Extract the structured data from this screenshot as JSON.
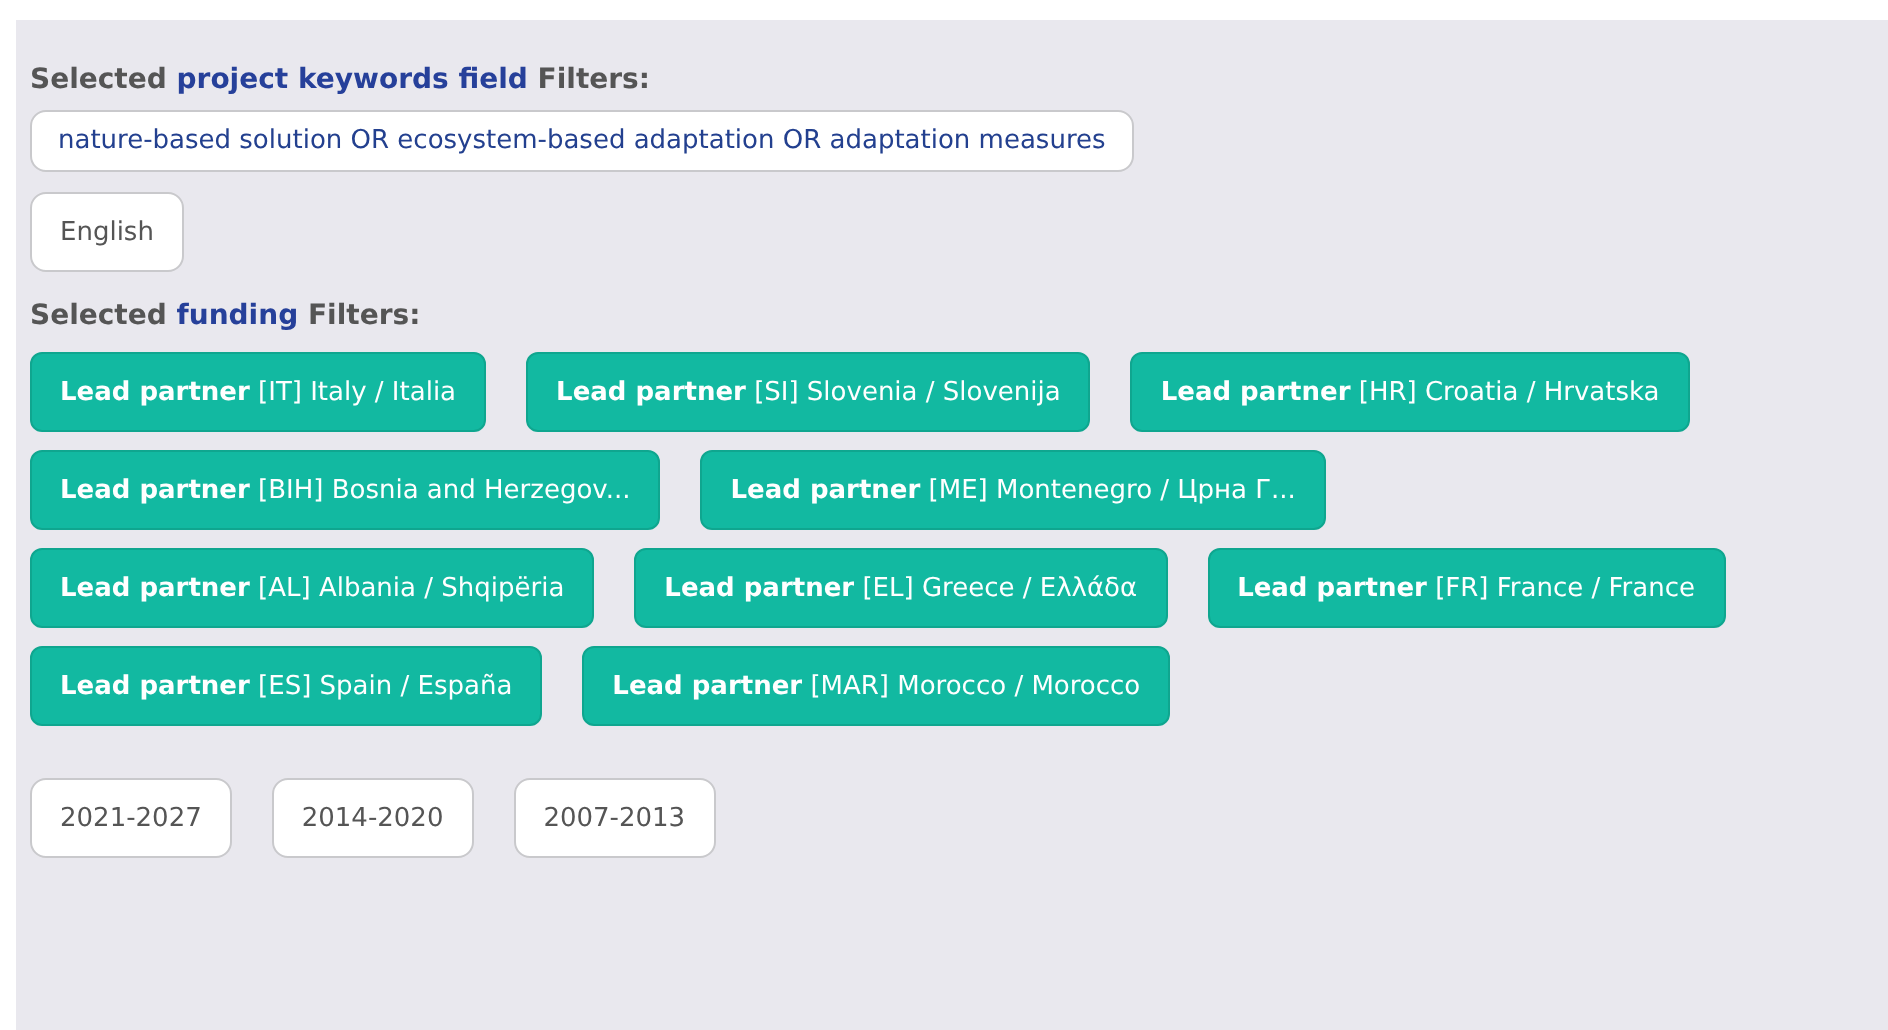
{
  "keywords_section": {
    "heading": {
      "before": "Selected",
      "highlight": "project keywords field",
      "after": "Filters:"
    },
    "query": "nature-based solution OR ecosystem-based adaptation OR adaptation measures",
    "languages": [
      "English"
    ]
  },
  "funding_section": {
    "heading": {
      "before": "Selected",
      "highlight": "funding",
      "after": "Filters:"
    },
    "tags": [
      "**Lead partner** [IT] Italy / Italia",
      "**Lead partner** [SI] Slovenia / Slovenija",
      "**Lead partner** [HR] Croatia / Hrvatska",
      "**Lead partner** [BIH] Bosnia and Herzegov...",
      "**Lead partner** [ME] Montenegro / Црна Г...",
      "**Lead partner** [AL] Albania / Shqipëria",
      "**Lead partner** [EL] Greece / Ελλάδα",
      "**Lead partner** [FR] France / France",
      "**Lead partner** [ES] Spain / España",
      "**Lead partner** [MAR] Morocco / Morocco"
    ],
    "periods": [
      "2021-2027",
      "2014-2020",
      "2007-2013"
    ]
  }
}
